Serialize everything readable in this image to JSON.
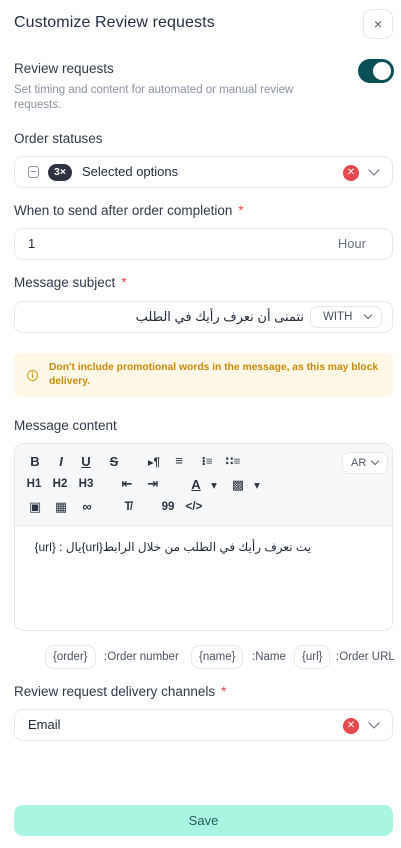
{
  "header": {
    "title": "Customize Review requests",
    "close_icon": "×"
  },
  "review_requests": {
    "label": "Review requests",
    "enabled": true,
    "description": "Set timing and content for automated or manual review requests."
  },
  "order_statuses": {
    "label": "Order statuses",
    "chip": "3×",
    "value": "Selected options"
  },
  "timing": {
    "label": "When to send after order completion",
    "required_mark": "*",
    "value": "1",
    "unit": "Hour"
  },
  "subject": {
    "label": "Message subject",
    "required_mark": "*",
    "value": "نتمنى أن نعرف رأيك في الطلب",
    "with_button": "WITH"
  },
  "warning": {
    "icon": "i",
    "text": "Don't include promotional words in the message, as this may block delivery."
  },
  "content": {
    "label": "Message content",
    "lang": "AR",
    "text": "يت نعرف رأيك في الطلب من خلال الرابط{url}يال : {url}",
    "toolbar": {
      "bold": "B",
      "italic": "I",
      "underline": "U",
      "strike": "S",
      "h1": "H1",
      "h2": "H2",
      "h3": "H3",
      "quote": "99",
      "code": "</>"
    }
  },
  "variables": [
    {
      "tag": "{order}",
      "label": ":Order number"
    },
    {
      "tag": "{name}",
      "label": ":Name"
    },
    {
      "tag": "{url}",
      "label": ":Order URL"
    }
  ],
  "channels": {
    "label": "Review request delivery channels",
    "required_mark": "*",
    "value": "Email"
  },
  "save_label": "Save",
  "colors": {
    "toggle_on": "#0b4f56",
    "save_bg": "#a8f5e1",
    "warn_bg": "#fff8e6",
    "danger": "#e5484d"
  }
}
